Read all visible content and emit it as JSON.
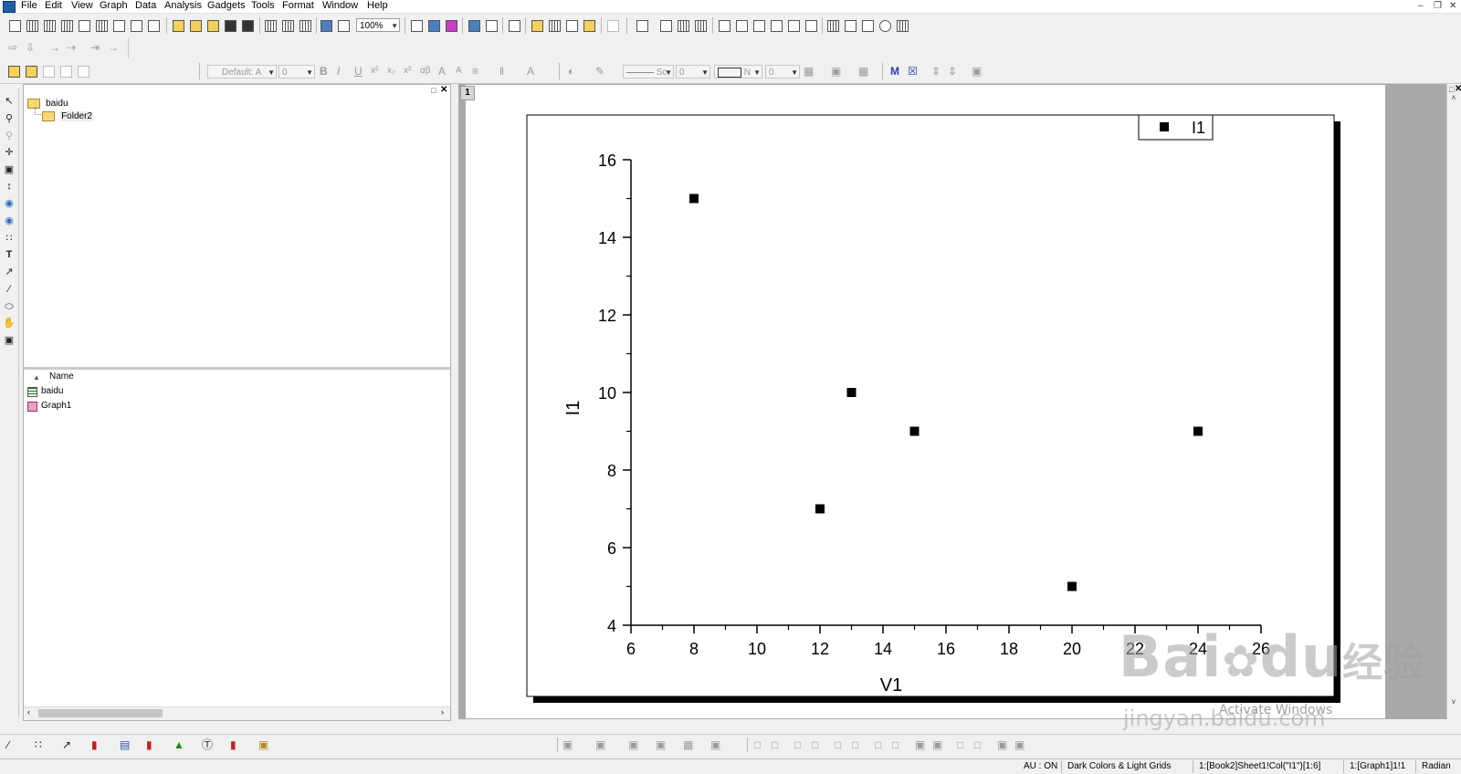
{
  "menu": [
    "File",
    "Edit",
    "View",
    "Graph",
    "Data",
    "Analysis",
    "Gadgets",
    "Tools",
    "Format",
    "Window",
    "Help"
  ],
  "toolbar": {
    "zoom": "100%",
    "font_combo": "Default: A",
    "font_size": "0",
    "line_style": "Sc",
    "line_width": "0",
    "fill": "N",
    "fill_width": "0"
  },
  "explorer": {
    "root_folder": "baidu",
    "sub_folder": "Folder2",
    "column_header": "Name",
    "items": [
      {
        "name": "baidu",
        "icon": "workbook-icon"
      },
      {
        "name": "Graph1",
        "icon": "graph-icon"
      }
    ]
  },
  "graph": {
    "layer_label": "1",
    "legend_label": "I1"
  },
  "chart_data": {
    "type": "scatter",
    "title": "",
    "xlabel": "V1",
    "ylabel": "I1",
    "xlim": [
      6,
      26
    ],
    "ylim": [
      4,
      16
    ],
    "xticks": [
      6,
      8,
      10,
      12,
      14,
      16,
      18,
      20,
      22,
      24,
      26
    ],
    "yticks": [
      4,
      6,
      8,
      10,
      12,
      14,
      16
    ],
    "series": [
      {
        "name": "I1",
        "marker": "square",
        "color": "#000000",
        "x": [
          8,
          12,
          13,
          15,
          20,
          24
        ],
        "y": [
          15,
          7,
          10,
          9,
          5,
          9
        ]
      }
    ],
    "legend_position": "top-right",
    "grid": false
  },
  "status": {
    "au": "AU : ON",
    "theme": "Dark Colors & Light Grids",
    "cell": "1:[Book2]Sheet1!Col(\"I1\")[1:6]",
    "graph": "1:[Graph1]1!1",
    "angle": "Radian"
  },
  "watermark": {
    "brand": "Bai",
    "brand2": "du",
    "cn": "经验",
    "url": "jingyan.baidu.com",
    "activate": "Activate Windows"
  }
}
